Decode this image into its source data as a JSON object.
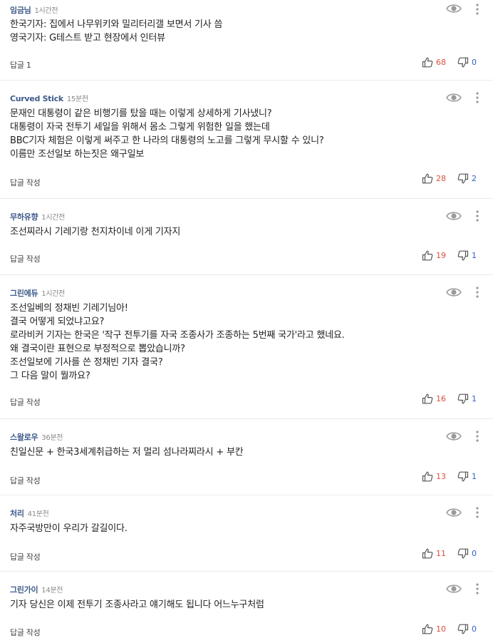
{
  "comments": [
    {
      "author": "임금님",
      "time": "1시간전",
      "lines": [
        "한국기자: 집에서 나무위키와 밀리터리갤 보면서 기사 씀",
        "영국기자: G테스트 받고 현장에서 인터뷰"
      ],
      "reply_label": "답글 1",
      "likes": "68",
      "dislikes": "0"
    },
    {
      "author": "Curved Stick",
      "time": "15분전",
      "lines": [
        "문재인 대통령이 같은 비행기를 탔을 때는 이렇게 상세하게 기사냈니?",
        "대통령이 자국 전투기 세일을 위해서 몸소 그렇게 위험한 일을 했는데",
        "BBC기자 체험은 이렇게 써주고 한 나라의 대통령의 노고를 그렇게 무시할 수 있니?",
        "이름만 조선일보 하는짓은 왜구일보"
      ],
      "reply_label": "답글 작성",
      "likes": "28",
      "dislikes": "2"
    },
    {
      "author": "무하유향",
      "time": "1시간전",
      "lines": [
        "조선찌라시 기레기랑 천지차이네 이게 기자지"
      ],
      "reply_label": "답글 작성",
      "likes": "19",
      "dislikes": "1"
    },
    {
      "author": "그린에듀",
      "time": "1시간전",
      "lines": [
        "조선일베의 정채빈 기레기님아!",
        "결국 어떻게 되었냐고요?",
        "로라비커 기자는 한국은 '작구 전투기를 자국 조종사가 조종하는 5번째 국가'라고 했네요.",
        "왜 결국이란 표현으로 부정적으로 뽑았습니까?",
        "조선일보에 기사를 쓴 정채빈 기자 결국?",
        "그 다음 말이 뭘까요?"
      ],
      "reply_label": "답글 작성",
      "likes": "16",
      "dislikes": "1"
    },
    {
      "author": "스왈로우",
      "time": "36분전",
      "lines": [
        "친일신문 + 한국3세계취급하는 저 멀리 섬나라찌라시 + 부칸"
      ],
      "reply_label": "답글 작성",
      "likes": "13",
      "dislikes": "1"
    },
    {
      "author": "처리",
      "time": "41분전",
      "lines": [
        "자주국방만이 우리가 갈길이다."
      ],
      "reply_label": "답글 작성",
      "likes": "11",
      "dislikes": "0"
    },
    {
      "author": "그린가이",
      "time": "14분전",
      "lines": [
        "기자 당신은  이제  전투기 조종사라고 얘기해도 됩니다    어느누구처럼"
      ],
      "reply_label": "답글 작성",
      "likes": "10",
      "dislikes": "0"
    }
  ],
  "icons": {
    "hide": "eye-icon",
    "more": "more-vertical-icon",
    "like": "thumbs-up-icon",
    "dislike": "thumbs-down-icon"
  },
  "colors": {
    "author": "#3e5a8a",
    "like_count": "#d94f3d",
    "dislike_count": "#2f5ec4"
  }
}
